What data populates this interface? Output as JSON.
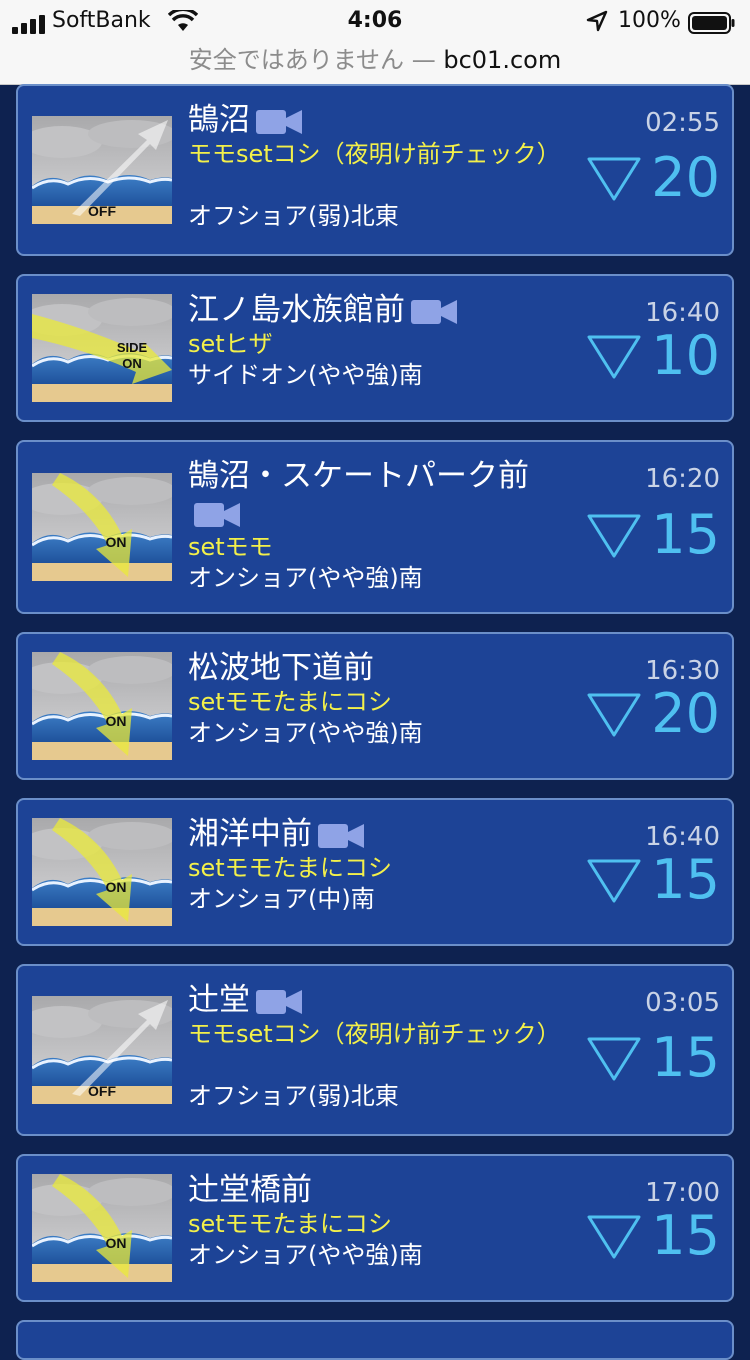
{
  "status_bar": {
    "carrier": "SoftBank",
    "time": "4:06",
    "battery": "100%",
    "signal_icon": "signal-bars-icon",
    "wifi_icon": "wifi-icon",
    "location_icon": "location-arrow-icon",
    "battery_icon": "battery-icon"
  },
  "url_bar": {
    "warning": "安全ではありません —",
    "domain": "bc01.com"
  },
  "spots": [
    {
      "name": "鵠沼",
      "camera": true,
      "condition": "モモsetコシ（夜明け前チェック）",
      "wind": "オフショア(弱)北東",
      "time": "02:55",
      "trend": "down",
      "score": "20",
      "wind_type": "OFF"
    },
    {
      "name": "江ノ島水族館前",
      "camera": true,
      "condition": "setヒザ",
      "wind": "サイドオン(やや強)南",
      "time": "16:40",
      "trend": "down",
      "score": "10",
      "wind_type": "SIDE ON"
    },
    {
      "name": "鵠沼・スケートパーク前",
      "camera": true,
      "condition": "setモモ",
      "wind": "オンショア(やや強)南",
      "time": "16:20",
      "trend": "down",
      "score": "15",
      "wind_type": "ON"
    },
    {
      "name": "松波地下道前",
      "camera": false,
      "condition": "setモモたまにコシ",
      "wind": "オンショア(やや強)南",
      "time": "16:30",
      "trend": "down",
      "score": "20",
      "wind_type": "ON"
    },
    {
      "name": "湘洋中前",
      "camera": true,
      "condition": "setモモたまにコシ",
      "wind": "オンショア(中)南",
      "time": "16:40",
      "trend": "down",
      "score": "15",
      "wind_type": "ON"
    },
    {
      "name": "辻堂",
      "camera": true,
      "condition": "モモsetコシ（夜明け前チェック）",
      "wind": "オフショア(弱)北東",
      "time": "03:05",
      "trend": "down",
      "score": "15",
      "wind_type": "OFF"
    },
    {
      "name": "辻堂橋前",
      "camera": false,
      "condition": "setモモたまにコシ",
      "wind": "オンショア(やや強)南",
      "time": "17:00",
      "trend": "down",
      "score": "15",
      "wind_type": "ON"
    }
  ],
  "colors": {
    "card_bg": "#1d4396",
    "card_border": "#6b8fc9",
    "condition_text": "#f3f04a",
    "score_text": "#4fc0f0",
    "camera_icon": "#8fa3e6"
  }
}
